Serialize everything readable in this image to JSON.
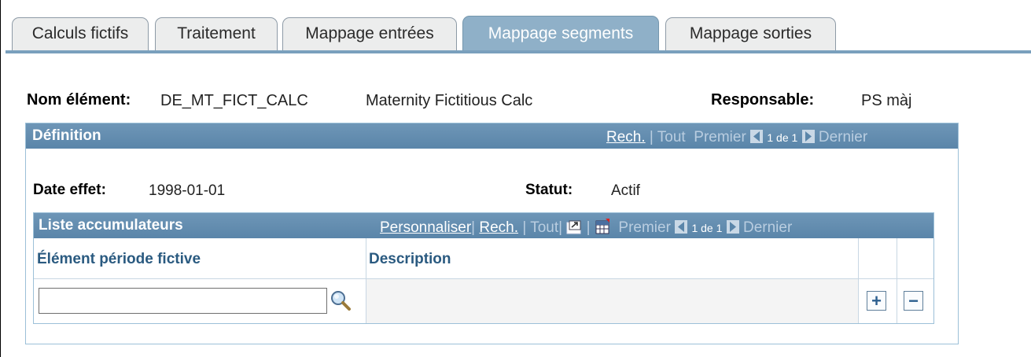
{
  "tabs": [
    {
      "label": "Calculs fictifs",
      "active": false
    },
    {
      "label": "Traitement",
      "active": false
    },
    {
      "label": "Mappage entrées",
      "active": false
    },
    {
      "label": "Mappage segments",
      "active": true
    },
    {
      "label": "Mappage sorties",
      "active": false
    }
  ],
  "header": {
    "element_label": "Nom élément:",
    "element_code": "DE_MT_FICT_CALC",
    "element_desc": "Maternity Fictitious Calc",
    "owner_label": "Responsable:",
    "owner_value": "PS màj"
  },
  "definition": {
    "title": "Définition",
    "nav": {
      "find": "Rech.",
      "sep": "|",
      "all": "Tout",
      "first": "Premier",
      "count": "1 de 1",
      "last": "Dernier"
    },
    "effdt_label": "Date effet:",
    "effdt_value": "1998-01-01",
    "status_label": "Statut:",
    "status_value": "Actif"
  },
  "accumulators": {
    "title": "Liste accumulateurs",
    "nav": {
      "customize": "Personnaliser",
      "sep": "|",
      "find": "Rech.",
      "all": "Tout",
      "first": "Premier",
      "count": "1 de 1",
      "last": "Dernier"
    },
    "columns": [
      "Élément période fictive",
      "Description"
    ],
    "rows": [
      {
        "element": "",
        "description": ""
      }
    ],
    "icons": {
      "zoom": "view-all-icon",
      "grid": "download-grid-icon",
      "lookup": "lookup-magnifier-icon",
      "add": "add-row-icon",
      "delete": "delete-row-icon"
    }
  },
  "colors": {
    "accent": "#5a85a9",
    "active_tab": "#8fb0c8",
    "header_text": "#2a5a80"
  }
}
